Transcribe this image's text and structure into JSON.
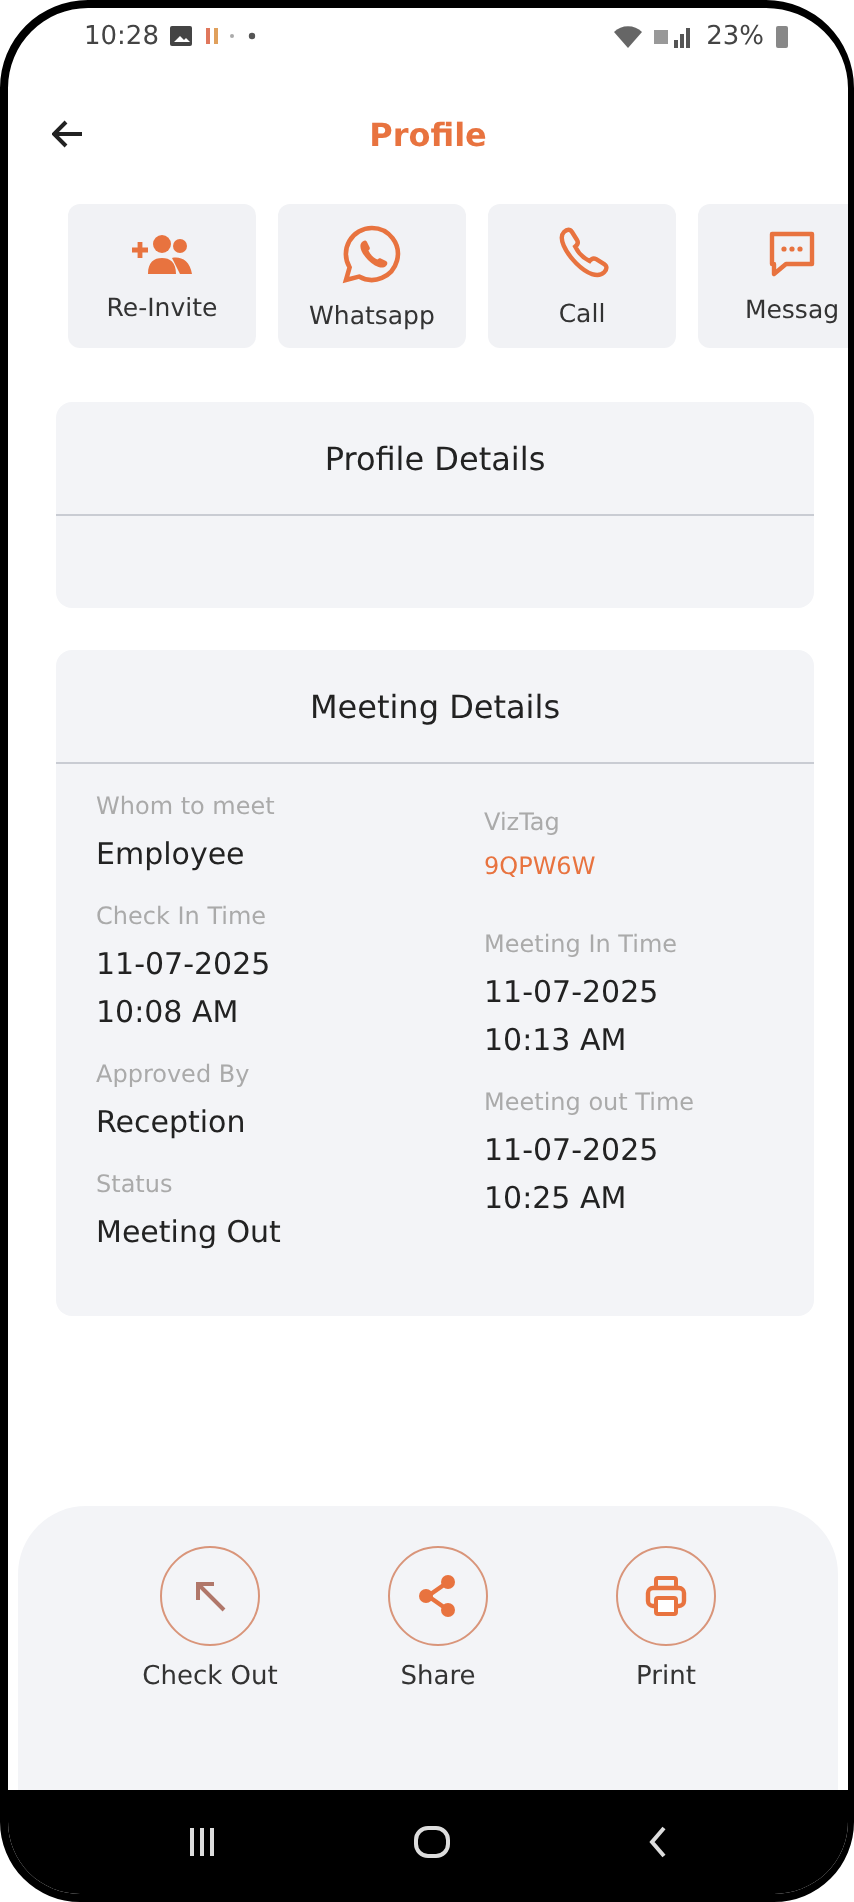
{
  "status_bar": {
    "time": "10:28",
    "battery": "23%"
  },
  "header": {
    "title": "Profile"
  },
  "actions": [
    {
      "label": "Re-Invite"
    },
    {
      "label": "Whatsapp"
    },
    {
      "label": "Call"
    },
    {
      "label": "Messag"
    }
  ],
  "profile_details": {
    "title": "Profile Details"
  },
  "meeting_details": {
    "title": "Meeting Details",
    "columns": [
      [
        {
          "label": "Whom to meet",
          "value": "Employee",
          "kind": "text"
        },
        {
          "label": "Check In Time",
          "value": "11-07-2025\n10:08 AM",
          "kind": "text"
        },
        {
          "label": "Approved By",
          "value": "Reception",
          "kind": "text"
        },
        {
          "label": "Status",
          "value": "Meeting Out",
          "kind": "text"
        }
      ],
      [
        {
          "label": "VizTag",
          "value": "9QPW6W",
          "kind": "code"
        },
        {
          "label": "Meeting In Time",
          "value": "11-07-2025\n10:13 AM",
          "kind": "text"
        },
        {
          "label": "Meeting out Time",
          "value": "11-07-2025\n10:25 AM",
          "kind": "text"
        }
      ]
    ]
  },
  "bottom_actions": [
    {
      "label": "Check Out"
    },
    {
      "label": "Share"
    },
    {
      "label": "Print"
    }
  ]
}
